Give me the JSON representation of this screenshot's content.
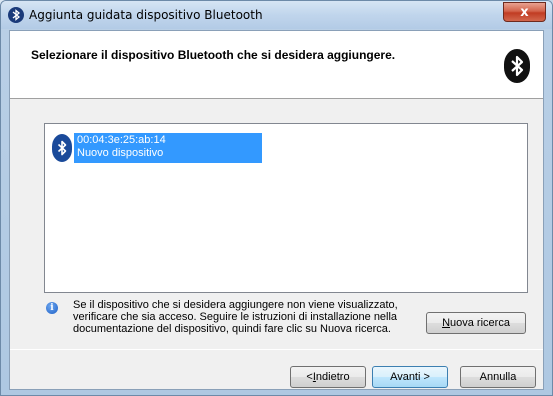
{
  "window": {
    "title": "Aggiunta guidata dispositivo Bluetooth",
    "close_label": "x"
  },
  "header": {
    "title": "Selezionare il dispositivo Bluetooth che si desidera aggiungere."
  },
  "devices": [
    {
      "address": "00:04:3e:25:ab:14",
      "name": "Nuovo dispositivo",
      "selected": true
    }
  ],
  "info": {
    "text": "Se il dispositivo che si desidera aggiungere non viene visualizzato, verificare che sia acceso. Seguire le istruzioni di installazione nella documentazione del dispositivo, quindi fare clic su Nuova ricerca."
  },
  "buttons": {
    "search_prefix": "",
    "search_accel": "N",
    "search_rest": "uova ricerca",
    "back_prefix": "< ",
    "back_accel": "I",
    "back_rest": "ndietro",
    "next": "Avanti >",
    "cancel": "Annulla"
  },
  "colors": {
    "selection": "#3399ff",
    "bluetooth_dark": "#111111",
    "bluetooth_blue": "#1a4a9a"
  },
  "icons": [
    "bluetooth-icon",
    "info-icon",
    "close-icon"
  ]
}
